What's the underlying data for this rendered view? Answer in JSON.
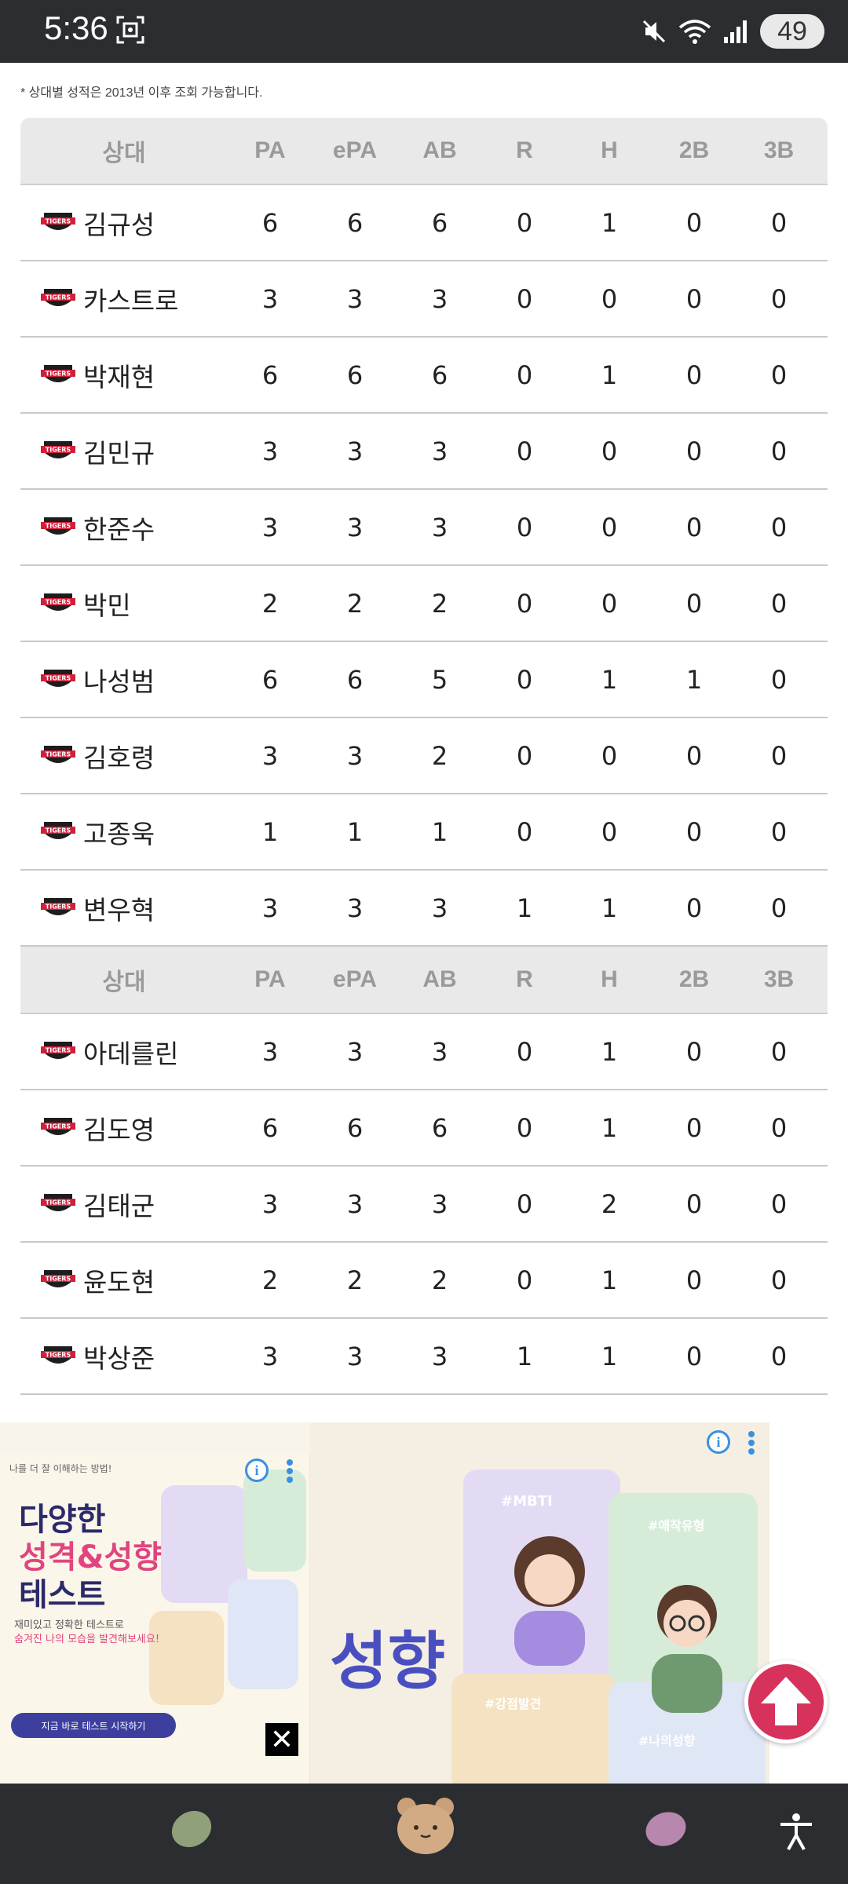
{
  "status": {
    "time": "5:36",
    "battery": "49"
  },
  "note": "* 상대별 성적은 2013년 이후 조회 가능합니다.",
  "table": {
    "headers": [
      "상대",
      "PA",
      "ePA",
      "AB",
      "R",
      "H",
      "2B",
      "3B"
    ],
    "section1": [
      [
        "김규성",
        "6",
        "6",
        "6",
        "0",
        "1",
        "0",
        "0"
      ],
      [
        "카스트로",
        "3",
        "3",
        "3",
        "0",
        "0",
        "0",
        "0"
      ],
      [
        "박재현",
        "6",
        "6",
        "6",
        "0",
        "1",
        "0",
        "0"
      ],
      [
        "김민규",
        "3",
        "3",
        "3",
        "0",
        "0",
        "0",
        "0"
      ],
      [
        "한준수",
        "3",
        "3",
        "3",
        "0",
        "0",
        "0",
        "0"
      ],
      [
        "박민",
        "2",
        "2",
        "2",
        "0",
        "0",
        "0",
        "0"
      ],
      [
        "나성범",
        "6",
        "6",
        "5",
        "0",
        "1",
        "1",
        "0"
      ],
      [
        "김호령",
        "3",
        "3",
        "2",
        "0",
        "0",
        "0",
        "0"
      ],
      [
        "고종욱",
        "1",
        "1",
        "1",
        "0",
        "0",
        "0",
        "0"
      ],
      [
        "변우혁",
        "3",
        "3",
        "3",
        "1",
        "1",
        "0",
        "0"
      ]
    ],
    "section2": [
      [
        "아데를린",
        "3",
        "3",
        "3",
        "0",
        "1",
        "0",
        "0"
      ],
      [
        "김도영",
        "6",
        "6",
        "6",
        "0",
        "1",
        "0",
        "0"
      ],
      [
        "김태군",
        "3",
        "3",
        "3",
        "0",
        "2",
        "0",
        "0"
      ],
      [
        "윤도현",
        "2",
        "2",
        "2",
        "0",
        "1",
        "0",
        "0"
      ],
      [
        "박상준",
        "3",
        "3",
        "3",
        "1",
        "1",
        "0",
        "0"
      ]
    ],
    "team_logo_text": "TIGERS"
  },
  "ad": {
    "headline1": "다양한",
    "headline2": "성격&성향",
    "headline3": "테스트",
    "top_caption": "나를 더 잘 이해하는 방법!",
    "sub1": "재미있고 정확한 테스트로",
    "sub2": "숨겨진 나의 모습을 발견해보세요!",
    "button": "지금 바로 테스트 시작하기",
    "big_text": "성향",
    "tag1": "#MBTI",
    "tag2": "#애착유형",
    "tag3": "#강점발견",
    "tag4": "#나의성향",
    "close": "✕",
    "info": "i"
  },
  "colors": {
    "status_bar": "#2b2d31",
    "header_bg": "#e9e9e9",
    "scroll_top": "#d6325c",
    "tigers_red": "#d21f3c"
  },
  "icons": {
    "mute": "mute-icon",
    "wifi": "wifi-icon",
    "signal": "signal-icon",
    "screenshot": "screenshot-icon",
    "nav_left": "green-bean-icon",
    "nav_center": "bear-face-icon",
    "nav_right": "purple-bean-icon",
    "accessibility": "accessibility-icon",
    "scroll_top": "arrow-up-icon"
  }
}
